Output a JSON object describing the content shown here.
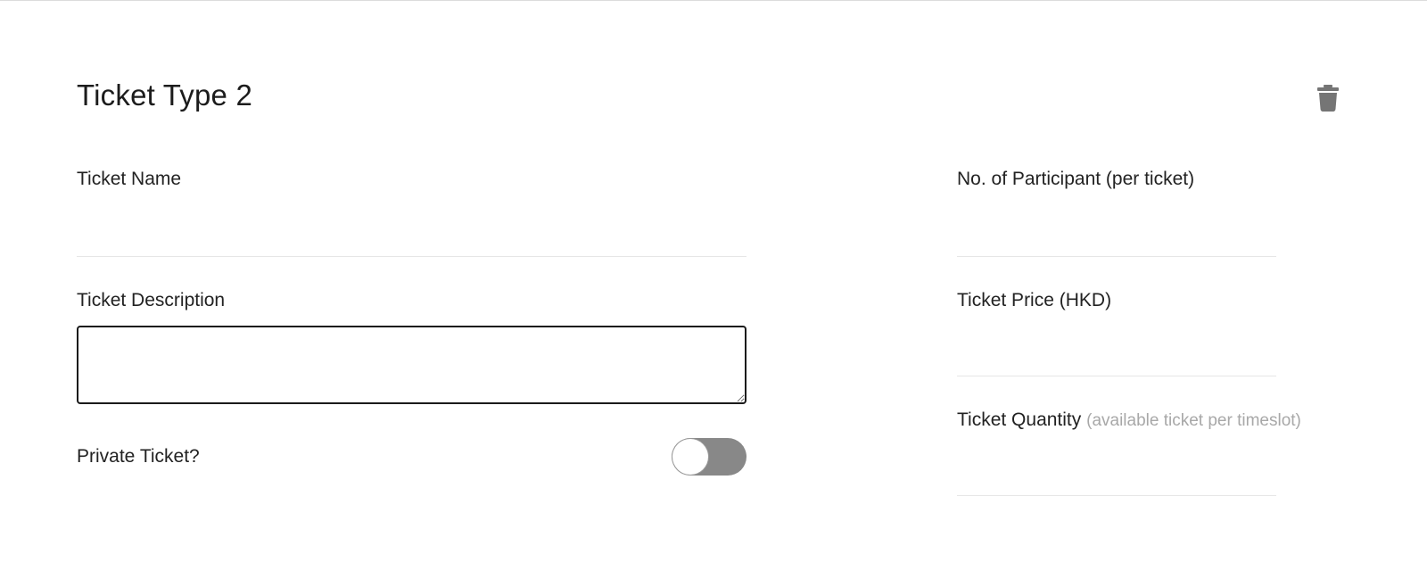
{
  "form": {
    "title": "Ticket Type 2",
    "delete_icon": "trash-icon",
    "ticket_name": {
      "label": "Ticket Name",
      "value": ""
    },
    "ticket_description": {
      "label": "Ticket Description",
      "value": ""
    },
    "private_ticket": {
      "label": "Private Ticket?",
      "enabled": false
    },
    "participants": {
      "label": "No. of Participant (per ticket)",
      "value": ""
    },
    "price": {
      "label": "Ticket Price (HKD)",
      "value": ""
    },
    "quantity": {
      "label": "Ticket Quantity",
      "hint": "(available ticket per timeslot)",
      "value": ""
    }
  },
  "colors": {
    "toggle_off": "#888888",
    "icon": "#757575",
    "hint_text": "#a8a8a8"
  }
}
